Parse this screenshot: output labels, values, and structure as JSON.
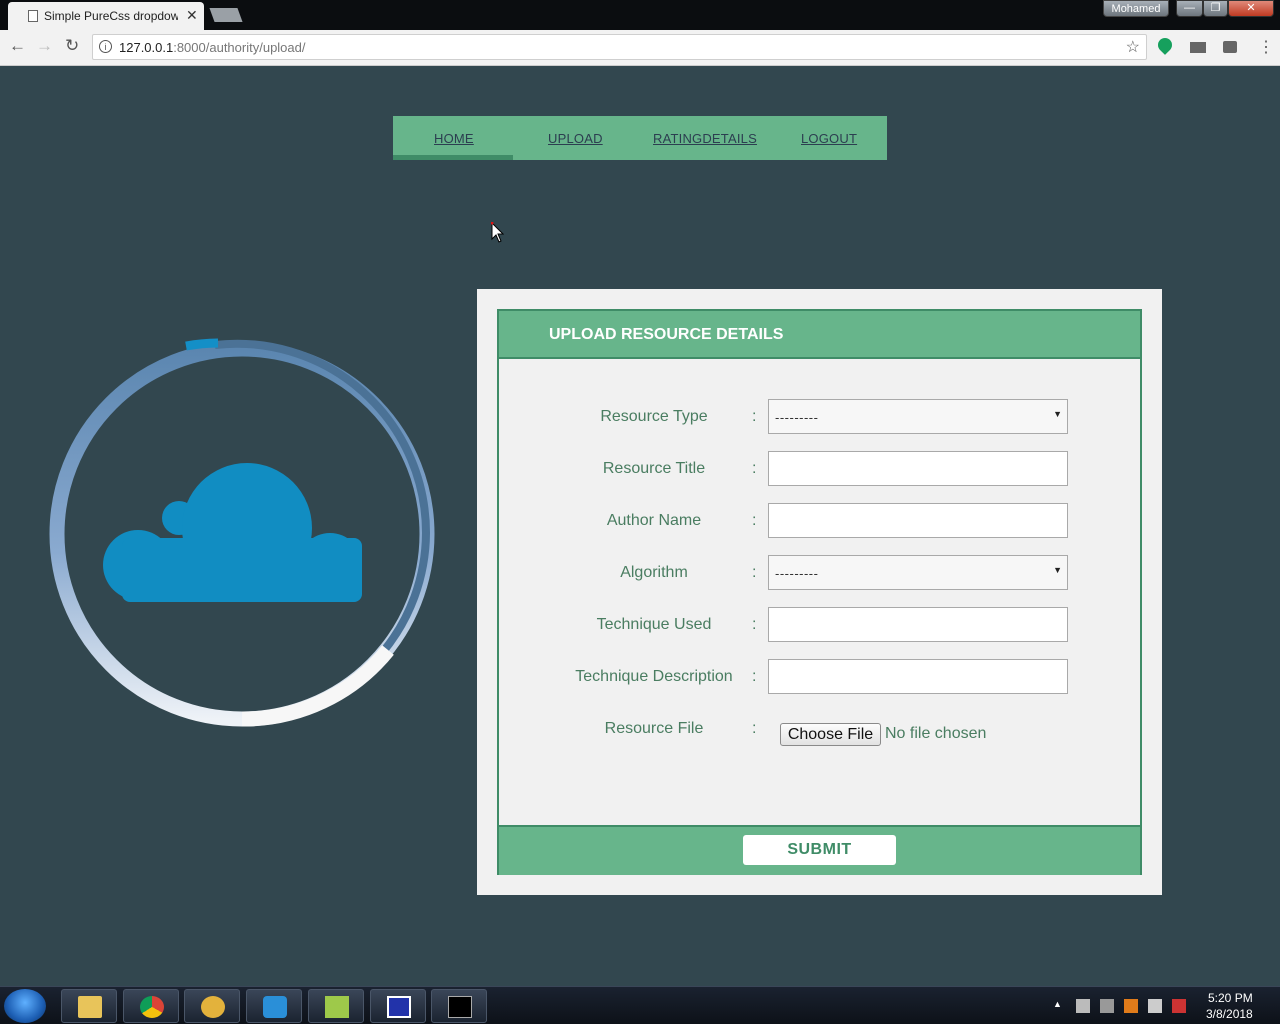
{
  "browser": {
    "tab_title": "Simple PureCss dropdow",
    "url_host": "127.0.0.1",
    "url_rest": ":8000/authority/upload/",
    "profile_name": "Mohamed"
  },
  "nav": {
    "items": [
      {
        "label": "HOME"
      },
      {
        "label": "UPLOAD"
      },
      {
        "label": "RATINGDETAILS"
      },
      {
        "label": "LOGOUT"
      }
    ],
    "active": "HOME"
  },
  "form": {
    "title": "UPLOAD RESOURCE DETAILS",
    "colon": ":",
    "fields": [
      {
        "label": "Resource Type",
        "type": "select",
        "value": "---------"
      },
      {
        "label": "Resource Title",
        "type": "text",
        "value": ""
      },
      {
        "label": "Author Name",
        "type": "text",
        "value": ""
      },
      {
        "label": "Algorithm",
        "type": "select",
        "value": "---------"
      },
      {
        "label": "Technique Used",
        "type": "text",
        "value": ""
      },
      {
        "label": "Technique Description",
        "type": "text",
        "value": ""
      },
      {
        "label": "Resource File",
        "type": "file",
        "value": ""
      }
    ],
    "file_button": "Choose File",
    "file_status": "No file chosen",
    "submit_label": "SUBMIT"
  },
  "colors": {
    "page_bg": "#32474f",
    "accent_green": "#67b58b",
    "dark_green": "#3f8c67",
    "label_green": "#4a7d61",
    "cloud_blue": "#118dc2"
  },
  "taskbar": {
    "time": "5:20 PM",
    "date": "3/8/2018",
    "apps": [
      "file-explorer-icon",
      "chrome-icon",
      "eclipse-icon",
      "app-icon",
      "notepad-icon",
      "vm-icon",
      "cmd-icon"
    ]
  }
}
